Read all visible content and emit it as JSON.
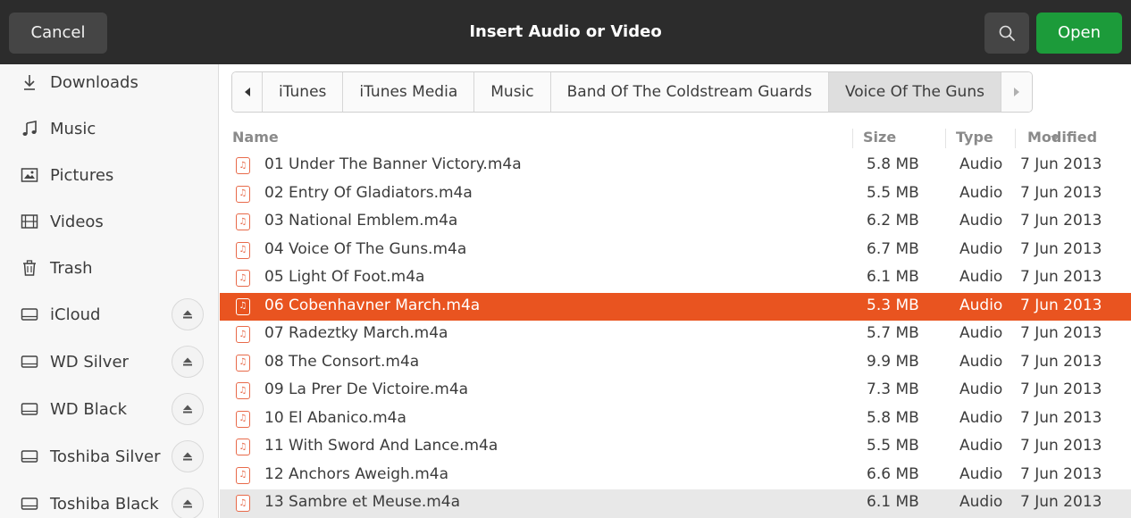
{
  "header": {
    "cancel_label": "Cancel",
    "title": "Insert Audio or Video",
    "open_label": "Open"
  },
  "sidebar": {
    "items": [
      {
        "label": "Downloads",
        "icon": "download-icon"
      },
      {
        "label": "Music",
        "icon": "music-note-icon"
      },
      {
        "label": "Pictures",
        "icon": "picture-icon"
      },
      {
        "label": "Videos",
        "icon": "film-icon"
      },
      {
        "label": "Trash",
        "icon": "trash-icon"
      },
      {
        "label": "iCloud",
        "icon": "drive-icon",
        "eject": true
      },
      {
        "label": "WD Silver",
        "icon": "drive-icon",
        "eject": true
      },
      {
        "label": "WD Black",
        "icon": "drive-icon",
        "eject": true
      },
      {
        "label": "Toshiba Silver",
        "icon": "drive-icon",
        "eject": true
      },
      {
        "label": "Toshiba Black",
        "icon": "drive-icon",
        "eject": true
      }
    ]
  },
  "pathbar": {
    "crumbs": [
      "iTunes",
      "iTunes Media",
      "Music",
      "Band Of The Coldstream Guards",
      "Voice Of The Guns"
    ]
  },
  "list": {
    "columns": {
      "name": "Name",
      "size": "Size",
      "type": "Type",
      "modified": "Modified"
    },
    "rows": [
      {
        "name": "01 Under The Banner Victory.m4a",
        "size": "5.8 MB",
        "type": "Audio",
        "modified": "7 Jun 2013"
      },
      {
        "name": "02 Entry Of Gladiators.m4a",
        "size": "5.5 MB",
        "type": "Audio",
        "modified": "7 Jun 2013"
      },
      {
        "name": "03 National Emblem.m4a",
        "size": "6.2 MB",
        "type": "Audio",
        "modified": "7 Jun 2013"
      },
      {
        "name": "04 Voice Of The Guns.m4a",
        "size": "6.7 MB",
        "type": "Audio",
        "modified": "7 Jun 2013"
      },
      {
        "name": "05 Light Of Foot.m4a",
        "size": "6.1 MB",
        "type": "Audio",
        "modified": "7 Jun 2013"
      },
      {
        "name": "06 Cobenhavner March.m4a",
        "size": "5.3 MB",
        "type": "Audio",
        "modified": "7 Jun 2013",
        "state": "selected"
      },
      {
        "name": "07 Radeztky March.m4a",
        "size": "5.7 MB",
        "type": "Audio",
        "modified": "7 Jun 2013"
      },
      {
        "name": "08 The Consort.m4a",
        "size": "9.9 MB",
        "type": "Audio",
        "modified": "7 Jun 2013"
      },
      {
        "name": "09 La Prer De Victoire.m4a",
        "size": "7.3 MB",
        "type": "Audio",
        "modified": "7 Jun 2013"
      },
      {
        "name": "10 El Abanico.m4a",
        "size": "5.8 MB",
        "type": "Audio",
        "modified": "7 Jun 2013"
      },
      {
        "name": "11 With Sword And Lance.m4a",
        "size": "5.5 MB",
        "type": "Audio",
        "modified": "7 Jun 2013"
      },
      {
        "name": "12 Anchors Aweigh.m4a",
        "size": "6.6 MB",
        "type": "Audio",
        "modified": "7 Jun 2013"
      },
      {
        "name": "13 Sambre et Meuse.m4a",
        "size": "6.1 MB",
        "type": "Audio",
        "modified": "7 Jun 2013",
        "state": "hover"
      }
    ]
  },
  "colors": {
    "header_bg": "#2c2c2c",
    "open_button": "#1c9b3a",
    "selection": "#e95420",
    "file_icon": "#e86a4a"
  }
}
